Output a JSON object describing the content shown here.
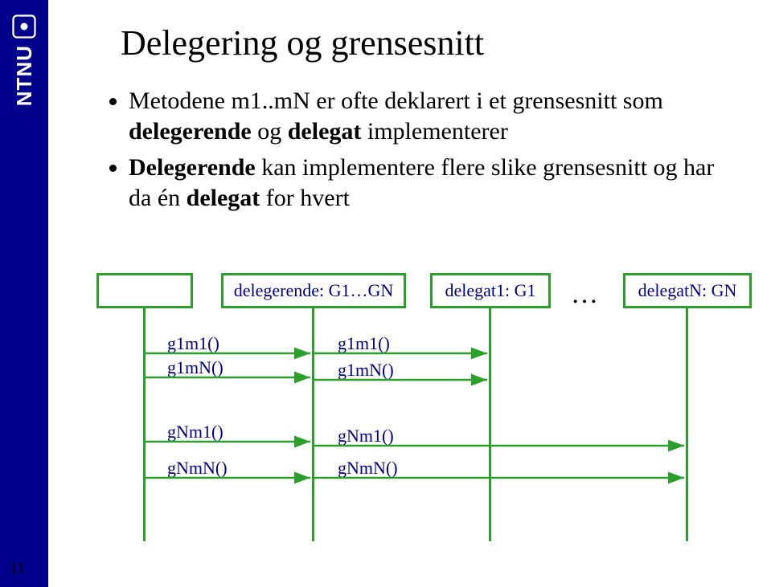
{
  "sidebar": {
    "org": "NTNU"
  },
  "title": "Delegering og grensesnitt",
  "bullets": [
    {
      "pre": "Metodene m1..mN er ofte deklarert i et grensesnitt som ",
      "bold1": "delegerende",
      "mid": " og ",
      "bold2": "delegat",
      "post": " implementerer"
    },
    {
      "pre": "",
      "bold1": "Delegerende",
      "mid": " kan implementere flere slike grensesnitt og har da én ",
      "bold2": "delegat",
      "post": " for hvert"
    }
  ],
  "diagram": {
    "boxes": {
      "caller": "",
      "delegerende": "delegerende: G1…GN",
      "delegat1": "delegat1: G1",
      "delegatN": "delegatN: GN"
    },
    "ellipsis": "…",
    "messages": {
      "g1m1_left": "g1m1()",
      "g1mN_left": "g1mN()",
      "g1m1_right": "g1m1()",
      "g1mN_right": "g1mN()",
      "gNm1_left": "gNm1()",
      "gNmN_left": "gNmN()",
      "gNm1_right": "gNm1()",
      "gNmN_right": "gNmN()"
    }
  },
  "page_number": "11"
}
